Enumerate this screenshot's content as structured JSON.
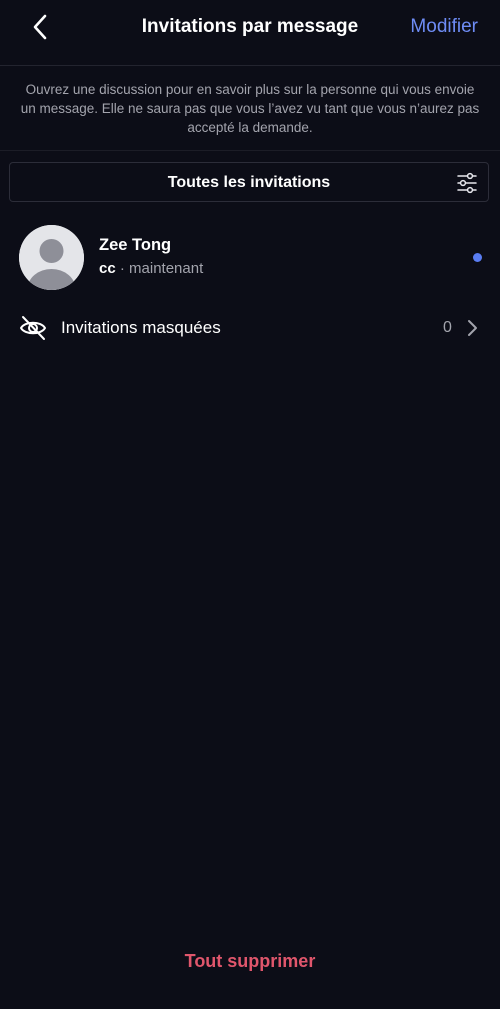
{
  "header": {
    "title": "Invitations par message",
    "edit_label": "Modifier",
    "back_icon": "chevron-left-icon"
  },
  "info": {
    "text": "Ouvrez une discussion pour en savoir plus sur la personne qui vous envoie un message. Elle ne saura pas que vous l’avez vu tant que vous n’aurez pas accepté la demande."
  },
  "filter": {
    "label": "Toutes les invitations",
    "icon": "sliders-icon"
  },
  "requests": [
    {
      "name": "Zee Tong",
      "preview": "cc",
      "separator": " · ",
      "time": "maintenant",
      "unread": true
    }
  ],
  "hidden": {
    "label": "Invitations masquées",
    "count": "0",
    "icon": "eye-off-icon"
  },
  "footer": {
    "delete_all_label": "Tout supprimer"
  },
  "colors": {
    "background": "#0c0d17",
    "accent": "#6e8cf5",
    "unread_dot": "#5a7df2",
    "destructive": "#e0566c",
    "secondary_text": "#a3a4ad"
  }
}
